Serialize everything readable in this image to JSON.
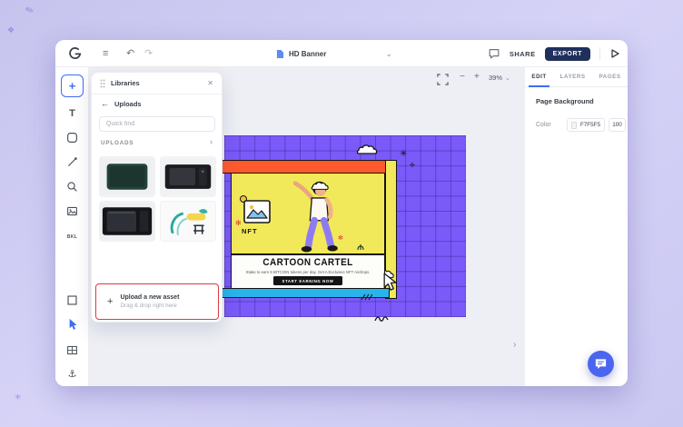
{
  "topbar": {
    "doc_title": "HD Banner",
    "share_label": "SHARE",
    "export_label": "EXPORT"
  },
  "toolbar": {
    "text_tool_label": "T",
    "bkl_tool_label": "BKL"
  },
  "canvas_controls": {
    "zoom_level": "39%"
  },
  "libraries_panel": {
    "title": "Libraries",
    "back_label": "Uploads",
    "search_placeholder": "Quick find",
    "section_label": "UPLOADS",
    "upload_cta": {
      "title": "Upload a new asset",
      "subtitle": "Drag & drop right here"
    }
  },
  "right_panel": {
    "tabs": [
      {
        "label": "EDIT"
      },
      {
        "label": "LAYERS"
      },
      {
        "label": "PAGES"
      }
    ],
    "section_title": "Page Background",
    "color_label": "Color",
    "color_value": "F7F5F5",
    "opacity_value": "100"
  },
  "banner": {
    "nft_label": "NFT",
    "title": "CARTOON CARTEL",
    "subtitle": "Stake to earn 5 BITCOIN tokens per day. Get A Exclusive NFT Airdrops.",
    "cta_label": "START EARNING NOW"
  },
  "icons": {
    "logo": "G",
    "menu": "≡",
    "undo": "↶",
    "redo": "↷",
    "chevron_down": "⌄",
    "close": "✕",
    "back_arrow": "←",
    "chevron_right": "›",
    "plus": "+",
    "minus": "−",
    "asterisk_large": "✳",
    "asterisk_small": "✢",
    "anchor": "⚓"
  },
  "colors": {
    "accent_blue": "#3D6DF2",
    "export_button": "#20305C",
    "artboard_purple": "#7A5AF8",
    "banner_orange": "#FF5A2E",
    "banner_yellow": "#F2E95A",
    "banner_cyan": "#27B5EA",
    "highlight_red": "#E0393E",
    "page_background_color": "#F7F5F5"
  }
}
